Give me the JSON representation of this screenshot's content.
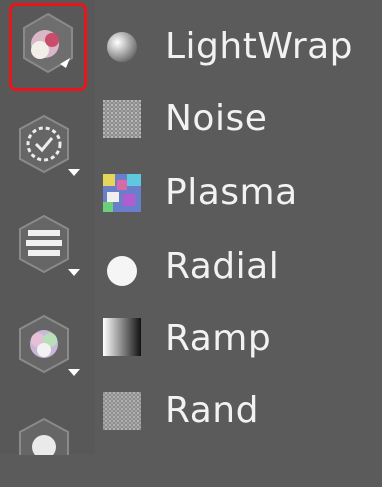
{
  "toolbar": {
    "tools": [
      {
        "name": "lightwrap-tool",
        "active": true
      },
      {
        "name": "clock-tool",
        "active": false
      },
      {
        "name": "stack-tool",
        "active": false
      },
      {
        "name": "color-tool",
        "active": false
      },
      {
        "name": "gear-tool",
        "active": false
      }
    ],
    "active_color": "#e8161b"
  },
  "menu": {
    "items": [
      {
        "label": "LightWrap",
        "icon": "sphere-icon"
      },
      {
        "label": "Noise",
        "icon": "noise-icon"
      },
      {
        "label": "Plasma",
        "icon": "plasma-icon"
      },
      {
        "label": "Radial",
        "icon": "radial-icon"
      },
      {
        "label": "Ramp",
        "icon": "ramp-icon"
      },
      {
        "label": "Rand",
        "icon": "rand-icon"
      }
    ]
  }
}
